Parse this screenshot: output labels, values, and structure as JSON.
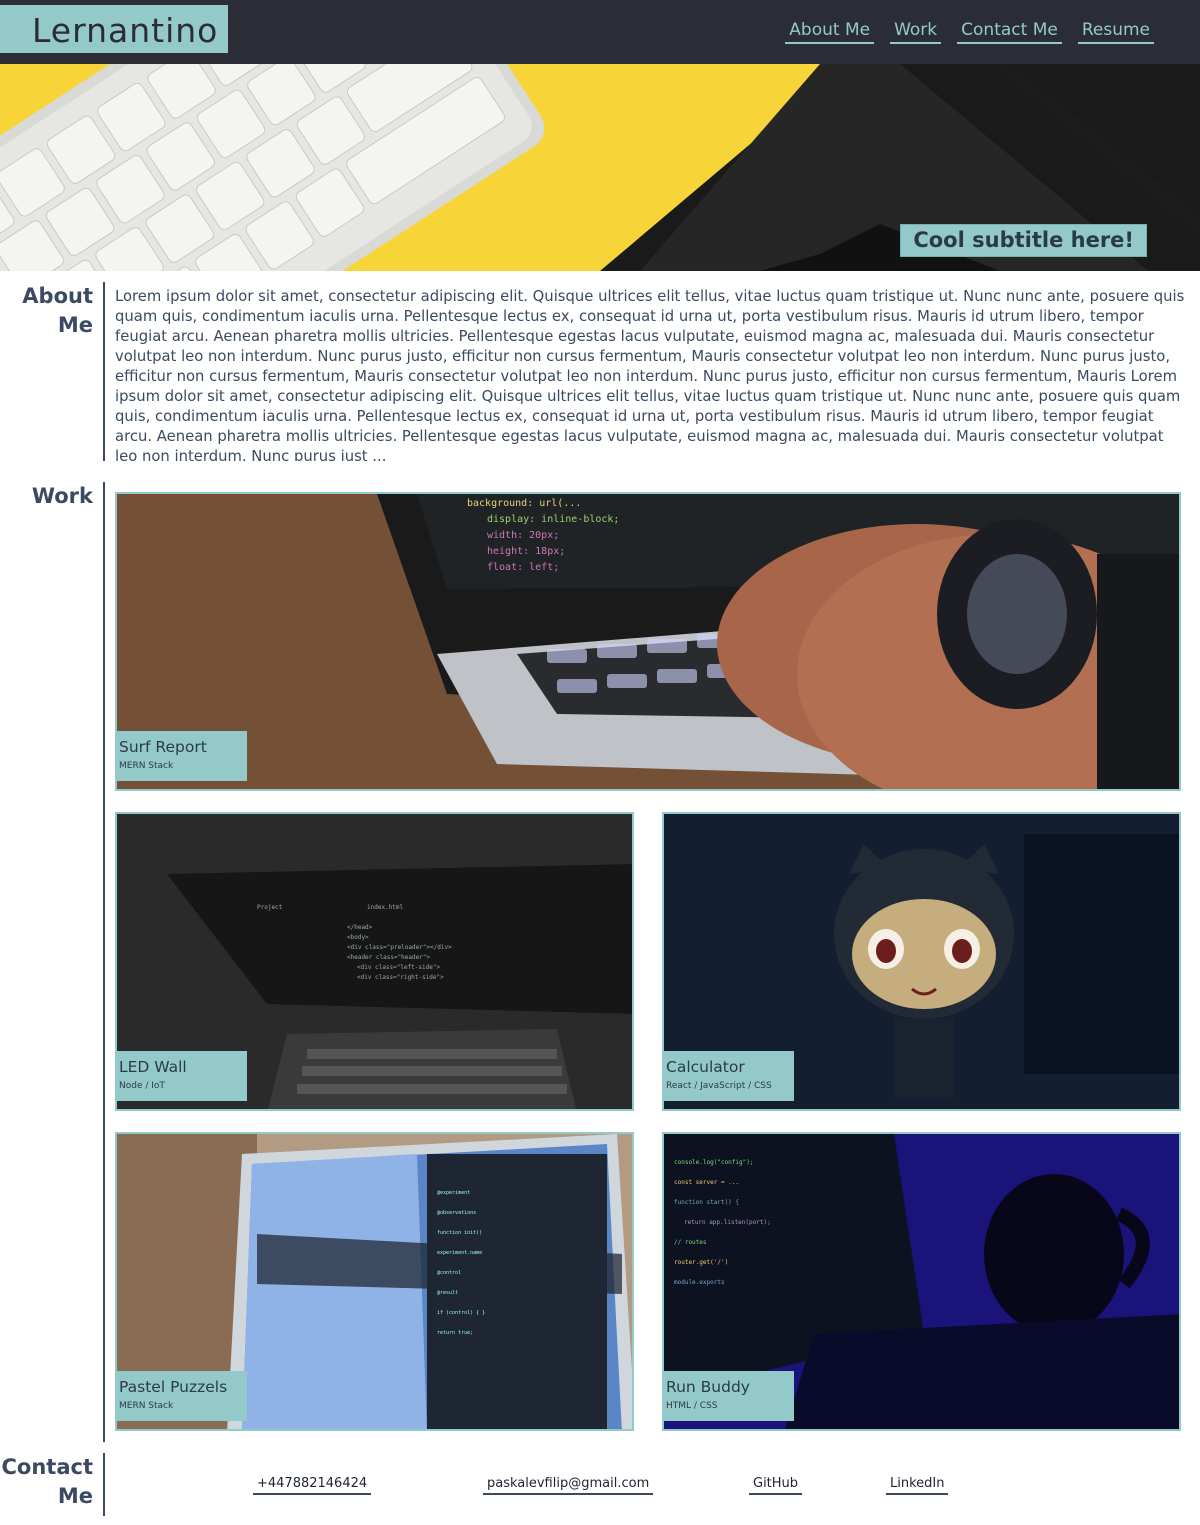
{
  "header": {
    "brand": "Lernantino",
    "nav": [
      "About Me",
      "Work",
      "Contact Me",
      "Resume"
    ]
  },
  "hero": {
    "subtitle": "Cool subtitle here!"
  },
  "about": {
    "heading_line1": "About",
    "heading_line2": "Me",
    "text": "Lorem ipsum dolor sit amet, consectetur adipiscing elit. Quisque ultrices elit tellus, vitae luctus quam tristique ut. Nunc nunc ante, posuere quis quam quis, condimentum iaculis urna. Pellentesque lectus ex, consequat id urna ut, porta vestibulum risus. Mauris id utrum libero, tempor feugiat arcu. Aenean pharetra mollis ultricies. Pellentesque egestas lacus vulputate, euismod magna ac, malesuada dui. Mauris consectetur volutpat leo non interdum. Nunc purus justo, efficitur non cursus fermentum, Mauris consectetur volutpat leo non interdum. Nunc purus justo, efficitur non cursus fermentum, Mauris consectetur volutpat leo non interdum. Nunc purus justo, efficitur non cursus fermentum, Mauris Lorem ipsum dolor sit amet, consectetur adipiscing elit. Quisque ultrices elit tellus, vitae luctus quam tristique ut. Nunc nunc ante, posuere quis quam quis, condimentum iaculis urna. Pellentesque lectus ex, consequat id urna ut, porta vestibulum risus. Mauris id utrum libero, tempor feugiat arcu. Aenean pharetra mollis ultricies. Pellentesque egestas lacus vulputate, euismod magna ac, malesuada dui. Mauris consectetur volutpat leo non interdum. Nunc purus just ..."
  },
  "work": {
    "heading": "Work",
    "projects": [
      {
        "title": "Surf Report",
        "stack": "MERN Stack"
      },
      {
        "title": "LED Wall",
        "stack": "Node / IoT"
      },
      {
        "title": "Calculator",
        "stack": "React / JavaScript / CSS"
      },
      {
        "title": "Pastel Puzzels",
        "stack": "MERN Stack"
      },
      {
        "title": "Run Buddy",
        "stack": "HTML / CSS"
      }
    ]
  },
  "contact": {
    "heading_line1": "Contact",
    "heading_line2": "Me",
    "phone": "+447882146424",
    "email": "paskalevfilip@gmail.com",
    "github": "GitHub",
    "linkedin": "LinkedIn"
  },
  "colors": {
    "header_bg": "#2b2d36",
    "accent": "#94c9c9",
    "text": "#3b4a60",
    "hero_yellow": "#f7d538"
  }
}
